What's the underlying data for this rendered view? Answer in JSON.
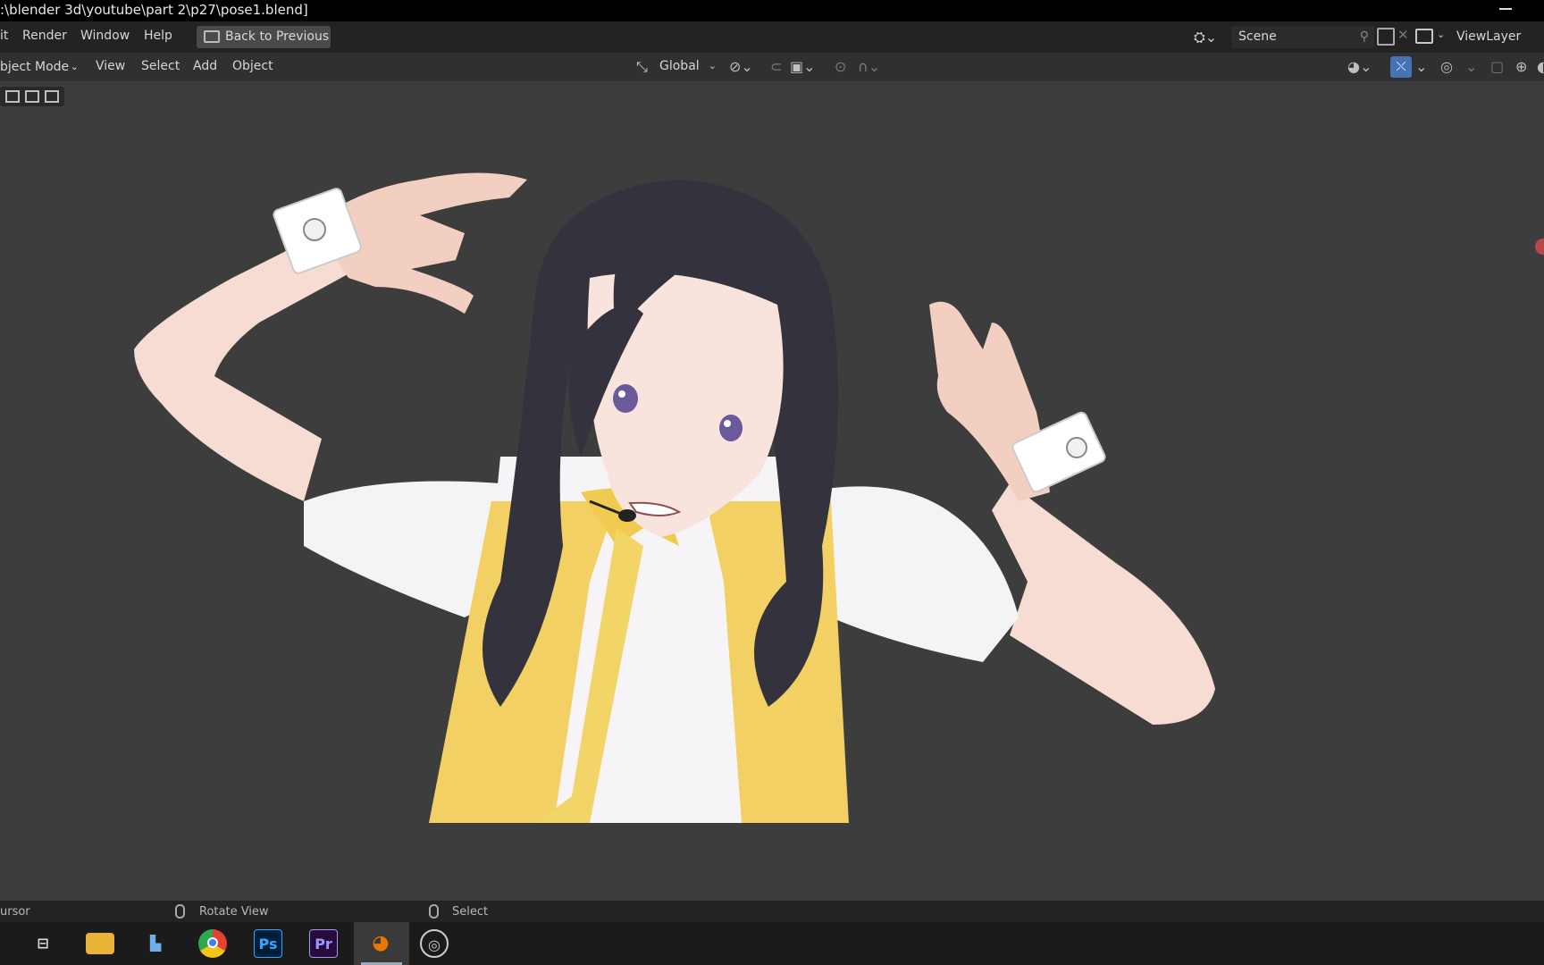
{
  "window": {
    "title": ":\\blender 3d\\youtube\\part 2\\p27\\pose1.blend]"
  },
  "topbar": {
    "menus": [
      "it",
      "Render",
      "Window",
      "Help"
    ],
    "back_button": "Back to Previous",
    "scene": "Scene",
    "view_layer": "ViewLayer"
  },
  "header3d": {
    "mode": "bject Mode",
    "menus": [
      "View",
      "Select",
      "Add",
      "Object"
    ],
    "orientation": "Global"
  },
  "statusbar": {
    "left": "ursor",
    "middle": "Rotate View",
    "right": "Select"
  },
  "taskbar": {
    "apps": [
      "task-view",
      "file-explorer",
      "network-folder",
      "chrome",
      "Ps",
      "Pr",
      "blender",
      "obs"
    ],
    "active": "blender"
  },
  "colors": {
    "accent": "#4772b3",
    "ps": "#31a8ff",
    "pr": "#9999ff",
    "blender": "#ea7600",
    "vest": "#f2d063",
    "hair": "#34323c"
  }
}
